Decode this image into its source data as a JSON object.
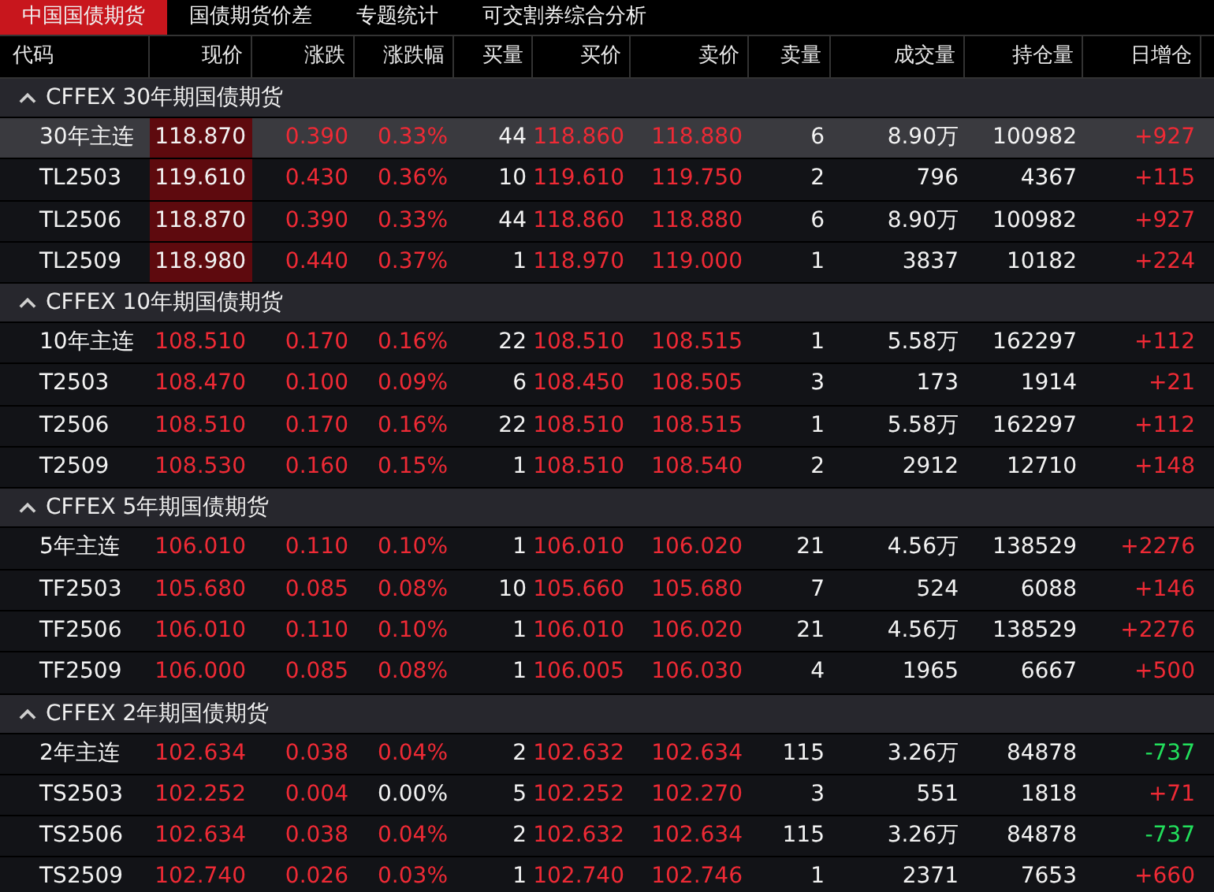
{
  "tabs": [
    {
      "label": "中国国债期货",
      "selected": true
    },
    {
      "label": "国债期货价差",
      "selected": false
    },
    {
      "label": "专题统计",
      "selected": false
    },
    {
      "label": "可交割券综合分析",
      "selected": false
    }
  ],
  "table": {
    "columns": [
      "代码",
      "现价",
      "涨跌",
      "涨跌幅",
      "买量",
      "买价",
      "卖价",
      "卖量",
      "成交量",
      "持仓量",
      "日增仓"
    ],
    "groups": [
      {
        "title": "CFFEX 30年期国债期货",
        "expanded": true,
        "rows": [
          {
            "code": "30年主连",
            "price": "118.870",
            "change": "0.390",
            "pct": "0.33%",
            "bid_vol": "44",
            "bid": "118.860",
            "ask": "118.880",
            "ask_vol": "6",
            "volume": "8.90万",
            "oi": "100982",
            "oi_change": "+927",
            "selected": true,
            "flash": true,
            "rising": true,
            "pct_nonzero": true,
            "oi_rising": true
          },
          {
            "code": "TL2503",
            "price": "119.610",
            "change": "0.430",
            "pct": "0.36%",
            "bid_vol": "10",
            "bid": "119.610",
            "ask": "119.750",
            "ask_vol": "2",
            "volume": "796",
            "oi": "4367",
            "oi_change": "+115",
            "selected": false,
            "flash": true,
            "rising": true,
            "pct_nonzero": true,
            "oi_rising": true
          },
          {
            "code": "TL2506",
            "price": "118.870",
            "change": "0.390",
            "pct": "0.33%",
            "bid_vol": "44",
            "bid": "118.860",
            "ask": "118.880",
            "ask_vol": "6",
            "volume": "8.90万",
            "oi": "100982",
            "oi_change": "+927",
            "selected": false,
            "flash": true,
            "rising": true,
            "pct_nonzero": true,
            "oi_rising": true
          },
          {
            "code": "TL2509",
            "price": "118.980",
            "change": "0.440",
            "pct": "0.37%",
            "bid_vol": "1",
            "bid": "118.970",
            "ask": "119.000",
            "ask_vol": "1",
            "volume": "3837",
            "oi": "10182",
            "oi_change": "+224",
            "selected": false,
            "flash": true,
            "rising": true,
            "pct_nonzero": true,
            "oi_rising": true
          }
        ]
      },
      {
        "title": "CFFEX 10年期国债期货",
        "expanded": true,
        "rows": [
          {
            "code": "10年主连",
            "price": "108.510",
            "change": "0.170",
            "pct": "0.16%",
            "bid_vol": "22",
            "bid": "108.510",
            "ask": "108.515",
            "ask_vol": "1",
            "volume": "5.58万",
            "oi": "162297",
            "oi_change": "+112",
            "selected": false,
            "flash": false,
            "rising": true,
            "pct_nonzero": true,
            "oi_rising": true
          },
          {
            "code": "T2503",
            "price": "108.470",
            "change": "0.100",
            "pct": "0.09%",
            "bid_vol": "6",
            "bid": "108.450",
            "ask": "108.505",
            "ask_vol": "3",
            "volume": "173",
            "oi": "1914",
            "oi_change": "+21",
            "selected": false,
            "flash": false,
            "rising": true,
            "pct_nonzero": true,
            "oi_rising": true
          },
          {
            "code": "T2506",
            "price": "108.510",
            "change": "0.170",
            "pct": "0.16%",
            "bid_vol": "22",
            "bid": "108.510",
            "ask": "108.515",
            "ask_vol": "1",
            "volume": "5.58万",
            "oi": "162297",
            "oi_change": "+112",
            "selected": false,
            "flash": false,
            "rising": true,
            "pct_nonzero": true,
            "oi_rising": true
          },
          {
            "code": "T2509",
            "price": "108.530",
            "change": "0.160",
            "pct": "0.15%",
            "bid_vol": "1",
            "bid": "108.510",
            "ask": "108.540",
            "ask_vol": "2",
            "volume": "2912",
            "oi": "12710",
            "oi_change": "+148",
            "selected": false,
            "flash": false,
            "rising": true,
            "pct_nonzero": true,
            "oi_rising": true
          }
        ]
      },
      {
        "title": "CFFEX 5年期国债期货",
        "expanded": true,
        "rows": [
          {
            "code": "5年主连",
            "price": "106.010",
            "change": "0.110",
            "pct": "0.10%",
            "bid_vol": "1",
            "bid": "106.010",
            "ask": "106.020",
            "ask_vol": "21",
            "volume": "4.56万",
            "oi": "138529",
            "oi_change": "+2276",
            "selected": false,
            "flash": false,
            "rising": true,
            "pct_nonzero": true,
            "oi_rising": true
          },
          {
            "code": "TF2503",
            "price": "105.680",
            "change": "0.085",
            "pct": "0.08%",
            "bid_vol": "10",
            "bid": "105.660",
            "ask": "105.680",
            "ask_vol": "7",
            "volume": "524",
            "oi": "6088",
            "oi_change": "+146",
            "selected": false,
            "flash": false,
            "rising": true,
            "pct_nonzero": true,
            "oi_rising": true
          },
          {
            "code": "TF2506",
            "price": "106.010",
            "change": "0.110",
            "pct": "0.10%",
            "bid_vol": "1",
            "bid": "106.010",
            "ask": "106.020",
            "ask_vol": "21",
            "volume": "4.56万",
            "oi": "138529",
            "oi_change": "+2276",
            "selected": false,
            "flash": false,
            "rising": true,
            "pct_nonzero": true,
            "oi_rising": true
          },
          {
            "code": "TF2509",
            "price": "106.000",
            "change": "0.085",
            "pct": "0.08%",
            "bid_vol": "1",
            "bid": "106.005",
            "ask": "106.030",
            "ask_vol": "4",
            "volume": "1965",
            "oi": "6667",
            "oi_change": "+500",
            "selected": false,
            "flash": false,
            "rising": true,
            "pct_nonzero": true,
            "oi_rising": true
          }
        ]
      },
      {
        "title": "CFFEX 2年期国债期货",
        "expanded": true,
        "rows": [
          {
            "code": "2年主连",
            "price": "102.634",
            "change": "0.038",
            "pct": "0.04%",
            "bid_vol": "2",
            "bid": "102.632",
            "ask": "102.634",
            "ask_vol": "115",
            "volume": "3.26万",
            "oi": "84878",
            "oi_change": "-737",
            "selected": false,
            "flash": false,
            "rising": true,
            "pct_nonzero": true,
            "oi_rising": false
          },
          {
            "code": "TS2503",
            "price": "102.252",
            "change": "0.004",
            "pct": "0.00%",
            "bid_vol": "5",
            "bid": "102.252",
            "ask": "102.270",
            "ask_vol": "3",
            "volume": "551",
            "oi": "1818",
            "oi_change": "+71",
            "selected": false,
            "flash": false,
            "rising": true,
            "pct_nonzero": false,
            "oi_rising": true
          },
          {
            "code": "TS2506",
            "price": "102.634",
            "change": "0.038",
            "pct": "0.04%",
            "bid_vol": "2",
            "bid": "102.632",
            "ask": "102.634",
            "ask_vol": "115",
            "volume": "3.26万",
            "oi": "84878",
            "oi_change": "-737",
            "selected": false,
            "flash": false,
            "rising": true,
            "pct_nonzero": true,
            "oi_rising": false
          },
          {
            "code": "TS2509",
            "price": "102.740",
            "change": "0.026",
            "pct": "0.03%",
            "bid_vol": "1",
            "bid": "102.740",
            "ask": "102.746",
            "ask_vol": "1",
            "volume": "2371",
            "oi": "7653",
            "oi_change": "+660",
            "selected": false,
            "flash": false,
            "rising": true,
            "pct_nonzero": true,
            "oi_rising": true
          }
        ]
      }
    ]
  }
}
